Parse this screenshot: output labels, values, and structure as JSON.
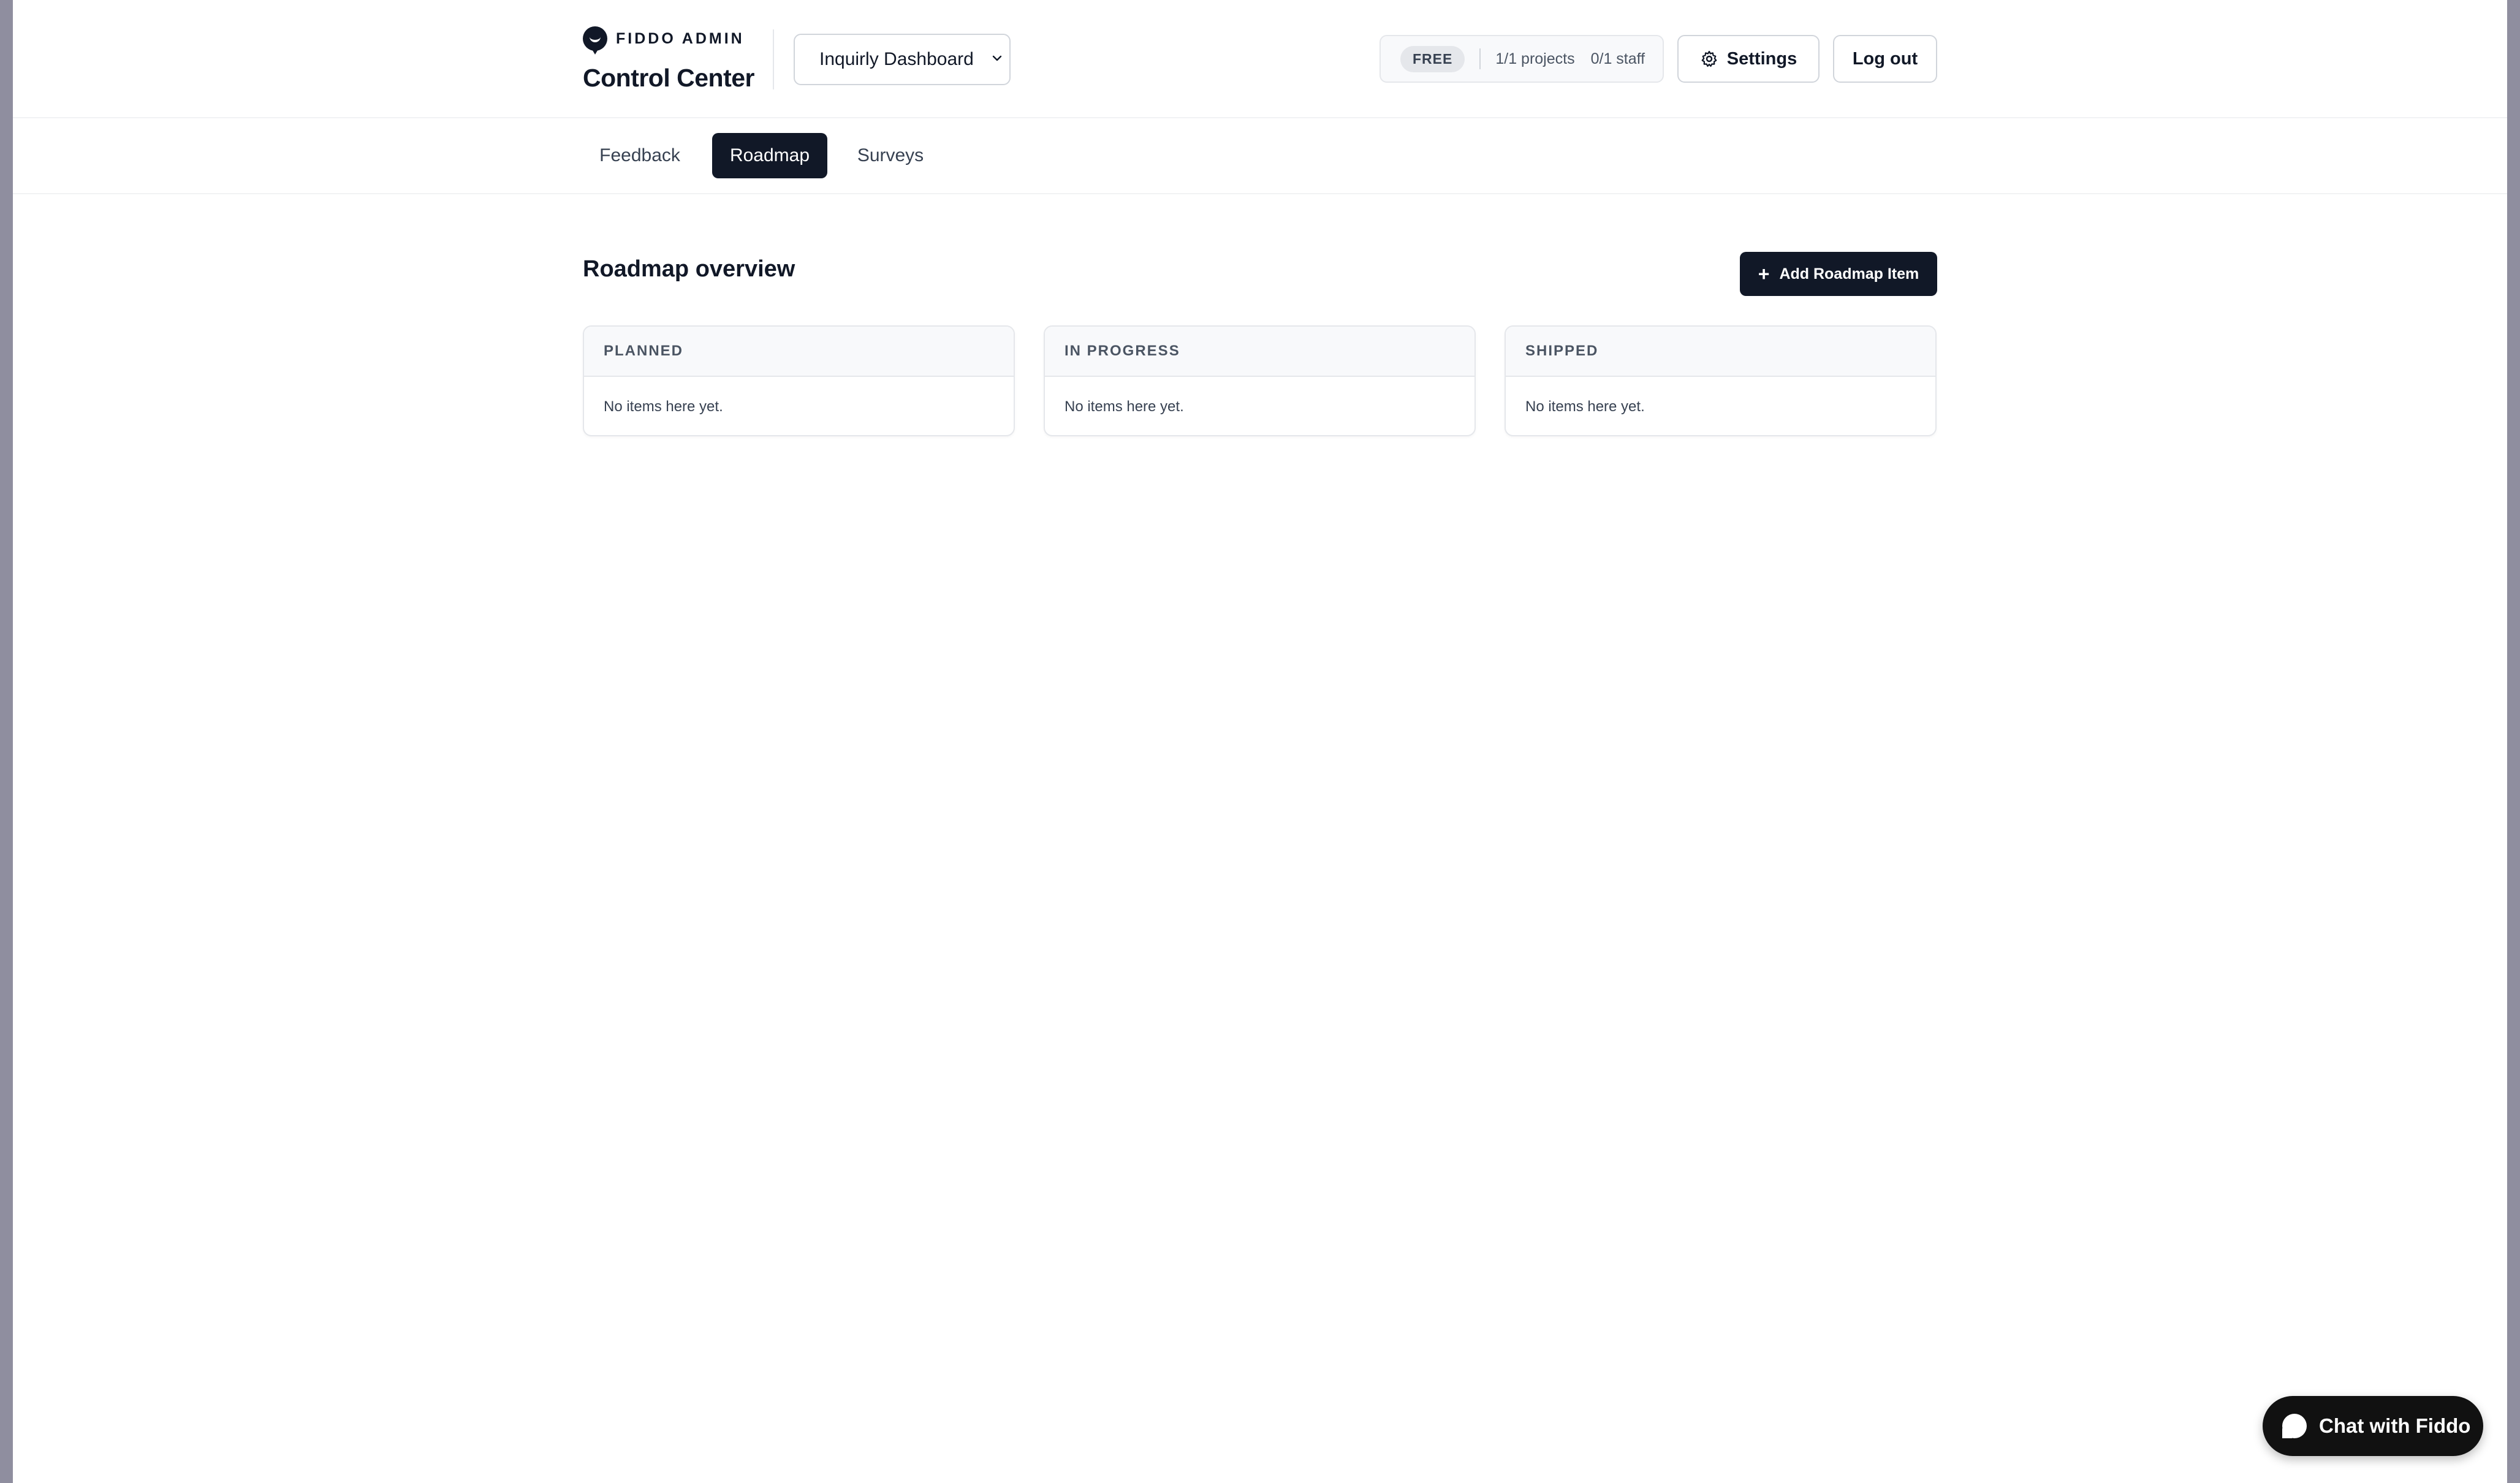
{
  "header": {
    "brand_small": "FIDDO ADMIN",
    "brand_title": "Control Center",
    "project_select": {
      "value": "Inquirly Dashboard"
    },
    "plan": {
      "badge": "FREE",
      "projects": "1/1 projects",
      "staff": "0/1 staff"
    },
    "settings_label": "Settings",
    "logout_label": "Log out"
  },
  "tabs": [
    {
      "label": "Feedback",
      "active": false
    },
    {
      "label": "Roadmap",
      "active": true
    },
    {
      "label": "Surveys",
      "active": false
    }
  ],
  "main": {
    "title": "Roadmap overview",
    "add_button_label": "Add Roadmap Item",
    "add_button_icon": "+",
    "columns": [
      {
        "title": "PLANNED",
        "empty_text": "No items here yet."
      },
      {
        "title": "IN PROGRESS",
        "empty_text": "No items here yet."
      },
      {
        "title": "SHIPPED",
        "empty_text": "No items here yet."
      }
    ]
  },
  "chat": {
    "label": "Chat with Fiddo"
  },
  "colors": {
    "primary": "#111827",
    "backdrop": "#8f8e9f",
    "border": "#e5e7eb",
    "muted_bg": "#f8f9fb"
  },
  "icons": {
    "brand": "chat-bubble-logo-icon",
    "settings": "gear-icon",
    "select": "chevron-down-icon",
    "chat": "chat-bubble-icon"
  }
}
